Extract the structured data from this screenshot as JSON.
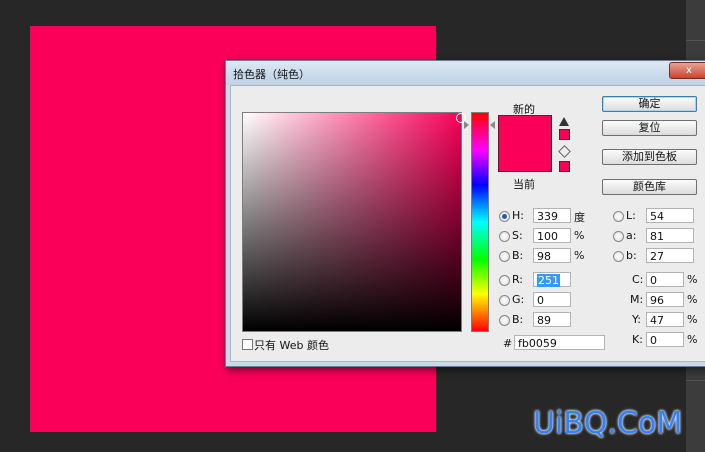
{
  "document": {
    "fill_color": "#fb0059"
  },
  "dialog": {
    "title": "拾色器（纯色）",
    "close_label": "x",
    "new_label": "新的",
    "current_label": "当前",
    "new_color": "#fb0059",
    "current_color": "#fb0059",
    "buttons": {
      "ok": "确定",
      "reset": "复位",
      "add_swatch": "添加到色板",
      "libraries": "颜色库"
    },
    "hsb": {
      "h": {
        "label": "H:",
        "value": "339",
        "unit": "度"
      },
      "s": {
        "label": "S:",
        "value": "100",
        "unit": "%"
      },
      "b": {
        "label": "B:",
        "value": "98",
        "unit": "%"
      }
    },
    "rgb": {
      "r": {
        "label": "R:",
        "value": "251"
      },
      "g": {
        "label": "G:",
        "value": "0"
      },
      "b": {
        "label": "B:",
        "value": "89"
      }
    },
    "lab": {
      "l": {
        "label": "L:",
        "value": "54"
      },
      "a": {
        "label": "a:",
        "value": "81"
      },
      "b": {
        "label": "b:",
        "value": "27"
      }
    },
    "cmyk": {
      "c": {
        "label": "C:",
        "value": "0",
        "unit": "%"
      },
      "m": {
        "label": "M:",
        "value": "96",
        "unit": "%"
      },
      "y": {
        "label": "Y:",
        "value": "47",
        "unit": "%"
      },
      "k": {
        "label": "K:",
        "value": "0",
        "unit": "%"
      }
    },
    "hex": {
      "label": "#",
      "value": "fb0059"
    },
    "web_only_label": "只有 Web 颜色",
    "selected_mode": "H"
  },
  "watermark": "UiBQ.CoM",
  "icons": [
    "warning-triangle-icon",
    "cube-icon",
    "close-icon"
  ]
}
